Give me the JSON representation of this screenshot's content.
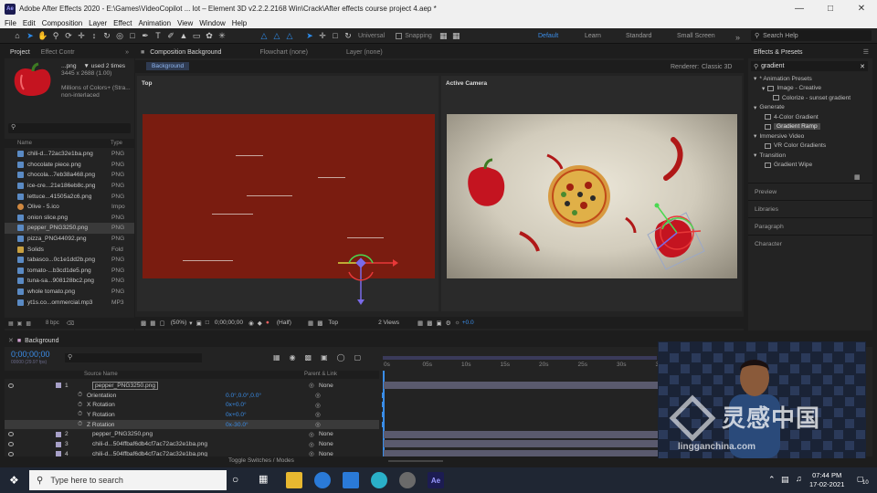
{
  "window": {
    "title": "Adobe After Effects 2020 - E:\\Games\\VideoCopilot ... lot – Element 3D v2.2.2.2168 Win\\Crack\\After effects course project 4.aep *",
    "app_badge": "Ae"
  },
  "menu": [
    "File",
    "Edit",
    "Composition",
    "Layer",
    "Effect",
    "Animation",
    "View",
    "Window",
    "Help"
  ],
  "toolbar": {
    "universal": "Universal",
    "snapping": "Snapping",
    "workspaces": [
      "Default",
      "Learn",
      "Standard",
      "Small Screen"
    ],
    "help_placeholder": "Search Help"
  },
  "project": {
    "tabs": [
      "Project",
      "Effect Contr"
    ],
    "selected": {
      "name": "...png",
      "used": "▼ used 2 times",
      "dims": "3445 x 2688 (1.00)",
      "colors": "Millions of Colors+ (Stra...",
      "interlace": "non-interlaced"
    },
    "columns": {
      "name": "Name",
      "type": "Type"
    },
    "items": [
      {
        "name": "chili-d...72ac32e1ba.png",
        "type": "PNG",
        "kind": "file"
      },
      {
        "name": "chocolate piece.png",
        "type": "PNG",
        "kind": "file"
      },
      {
        "name": "chocola...7eb38a468.png",
        "type": "PNG",
        "kind": "file"
      },
      {
        "name": "ice-cre...21e186eb8c.png",
        "type": "PNG",
        "kind": "file"
      },
      {
        "name": "lettuce...41505a2c6.png",
        "type": "PNG",
        "kind": "file"
      },
      {
        "name": "Olive - 5.ico",
        "type": "Impo",
        "kind": "ico"
      },
      {
        "name": "onion slice.png",
        "type": "PNG",
        "kind": "file"
      },
      {
        "name": "pepper_PNG3250.png",
        "type": "PNG",
        "kind": "file",
        "selected": true
      },
      {
        "name": "pizza_PNG44092.png",
        "type": "PNG",
        "kind": "file"
      },
      {
        "name": "Solids",
        "type": "Fold",
        "kind": "folder"
      },
      {
        "name": "tabasco...0c1e1dd2b.png",
        "type": "PNG",
        "kind": "file"
      },
      {
        "name": "tomato-...b3cd1de5.png",
        "type": "PNG",
        "kind": "file"
      },
      {
        "name": "tuna-sa...908128bc2.png",
        "type": "PNG",
        "kind": "file"
      },
      {
        "name": "whole tomato.png",
        "type": "PNG",
        "kind": "file"
      },
      {
        "name": "yt1s.co...ommercial.mp3",
        "type": "MP3",
        "kind": "file"
      }
    ],
    "bpc": "8 bpc"
  },
  "composition": {
    "tabs": [
      "Composition Background",
      "Flowchart (none)",
      "Layer (none)"
    ],
    "subtab": "Background",
    "renderer_label": "Renderer:",
    "renderer": "Classic 3D",
    "left_view": "Top",
    "right_view": "Active Camera",
    "footer": {
      "zoom": "(50%)",
      "time": "0;00;00;00",
      "res": "(Half)",
      "view": "Top",
      "views": "2 Views",
      "offset": "+0.0"
    }
  },
  "effects": {
    "title": "Effects & Presets",
    "search": "gradient",
    "tree": [
      {
        "label": "* Animation Presets",
        "level": 0
      },
      {
        "label": "Image - Creative",
        "level": 1
      },
      {
        "label": "Colorize - sunset gradient",
        "level": 2
      },
      {
        "label": "Generate",
        "level": 0
      },
      {
        "label": "4-Color Gradient",
        "level": 1
      },
      {
        "label": "Gradient Ramp",
        "level": 1,
        "selected": true
      },
      {
        "label": "Immersive Video",
        "level": 0
      },
      {
        "label": "VR Color Gradients",
        "level": 1
      },
      {
        "label": "Transition",
        "level": 0
      },
      {
        "label": "Gradient Wipe",
        "level": 1
      }
    ],
    "side": [
      "Preview",
      "Libraries",
      "Paragraph",
      "Character"
    ]
  },
  "timeline": {
    "comp": "Background",
    "timecode": "0;00;00;00",
    "fps": "00000 (29.97 fps)",
    "columns": {
      "source": "Source Name",
      "parent": "Parent & Link"
    },
    "ticks": [
      "0s",
      "05s",
      "10s",
      "15s",
      "20s",
      "25s",
      "30s",
      "35s"
    ],
    "rows": [
      {
        "num": "1",
        "name": "pepper_PNG3250.png",
        "parent": "None",
        "type": "layer"
      },
      {
        "name": "Orientation",
        "value": "0.0°,0.0°,0.0°",
        "type": "prop"
      },
      {
        "name": "X Rotation",
        "value": "0x+0.0°",
        "type": "prop"
      },
      {
        "name": "Y Rotation",
        "value": "0x+0.0°",
        "type": "prop"
      },
      {
        "name": "Z Rotation",
        "value": "0x-30.0°",
        "type": "prop"
      },
      {
        "num": "2",
        "name": "pepper_PNG3250.png",
        "parent": "None",
        "type": "layer"
      },
      {
        "num": "3",
        "name": "chili-d...504ffbaf6db4cf7ac72ac32e1ba.png",
        "parent": "None",
        "type": "layer"
      },
      {
        "num": "4",
        "name": "chili-d...504ffbaf6db4cf7ac72ac32e1ba.png",
        "parent": "None",
        "type": "layer"
      }
    ],
    "toggle": "Toggle Switches / Modes"
  },
  "watermark": {
    "cn": "灵感中国",
    "url": "lingganchina.com"
  },
  "taskbar": {
    "search": "Type here to search",
    "time": "07:44 PM",
    "date": "17-02-2021",
    "badge": "10"
  }
}
